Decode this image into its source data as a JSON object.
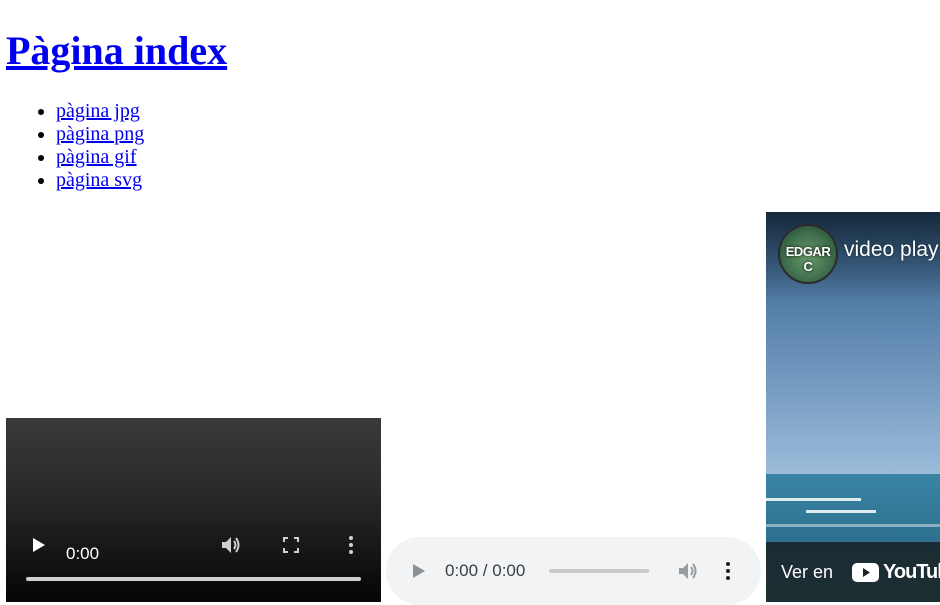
{
  "heading": {
    "title": "Pàgina index"
  },
  "links": [
    {
      "label": "pàgina jpg"
    },
    {
      "label": "pàgina png"
    },
    {
      "label": "pàgina gif"
    },
    {
      "label": "pàgina svg"
    }
  ],
  "video": {
    "current_time": "0:00",
    "progress": 0,
    "icons": [
      "play-icon",
      "volume-icon",
      "fullscreen-icon",
      "more-options-icon"
    ]
  },
  "audio": {
    "time_display": "0:00 / 0:00",
    "progress": 0,
    "icons": [
      "play-icon",
      "volume-icon",
      "more-options-icon"
    ]
  },
  "youtube": {
    "channel_avatar_text": "EDGAR C",
    "video_title": "video play",
    "watch_on_label": "Ver en",
    "brand_label": "YouTube"
  },
  "colors": {
    "link": "#0000ee",
    "audio_bg": "#f1f3f4",
    "video_bg": "#000000"
  }
}
